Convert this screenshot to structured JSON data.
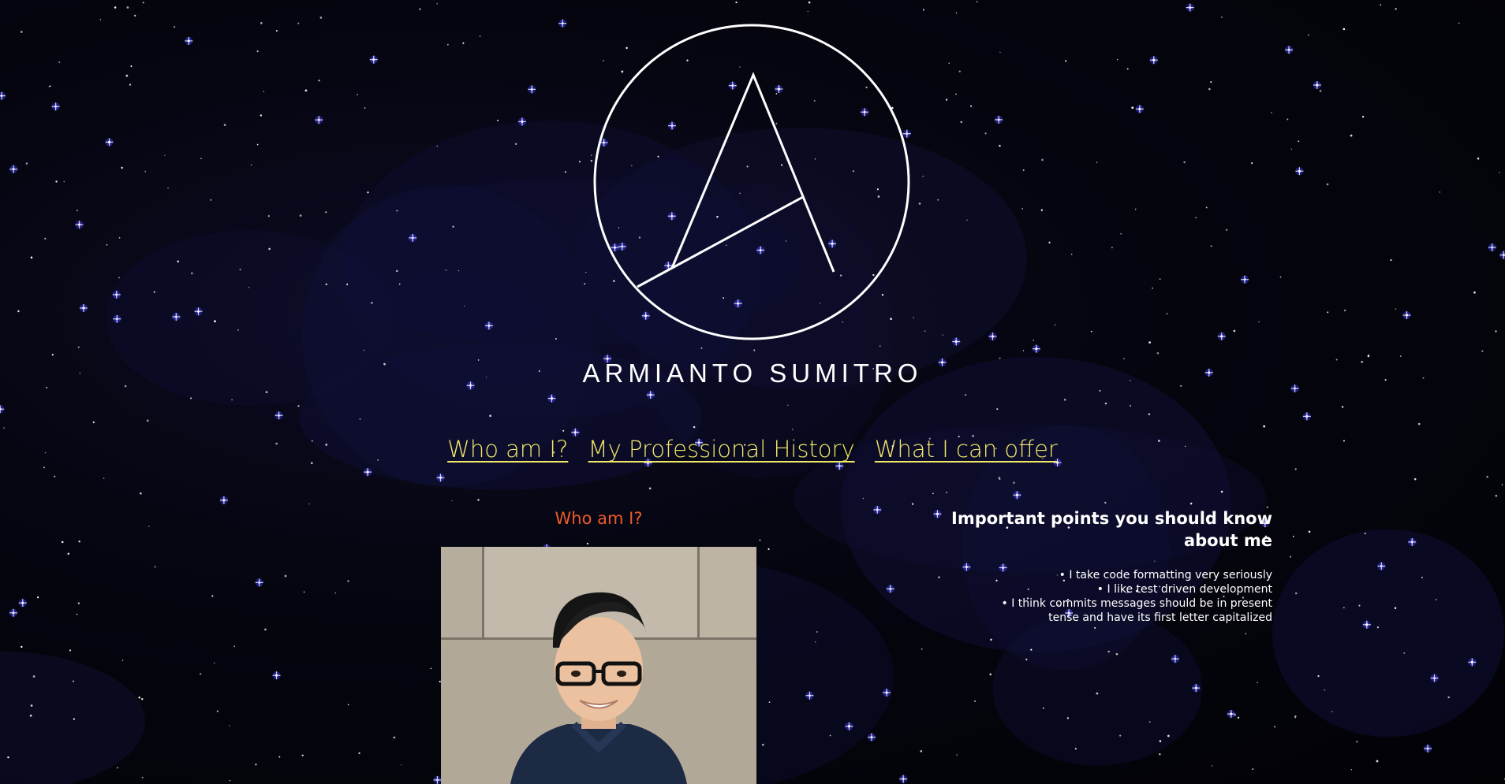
{
  "site": {
    "name": "ARMIANTO SUMITRO",
    "logo_icon": "letter-a-in-circle-icon"
  },
  "nav": {
    "links": [
      {
        "label": "Who am I?"
      },
      {
        "label": "My Professional History"
      },
      {
        "label": "What I can offer"
      }
    ]
  },
  "about": {
    "heading": "Who am I?",
    "portrait_icon": "profile-photo"
  },
  "points": {
    "heading": "Important points you should know about me",
    "items": [
      "I take code formatting very seriously",
      "I like test driven development",
      "I think commits messages should be in present tense and have its first letter capitalized"
    ]
  },
  "colors": {
    "background": "#03030c",
    "nav_link": "#f2e86a",
    "section_heading_accent": "#ec5a2c",
    "text": "#ffffff",
    "star": "#ffffff",
    "star_glow": "#3d3dff"
  }
}
